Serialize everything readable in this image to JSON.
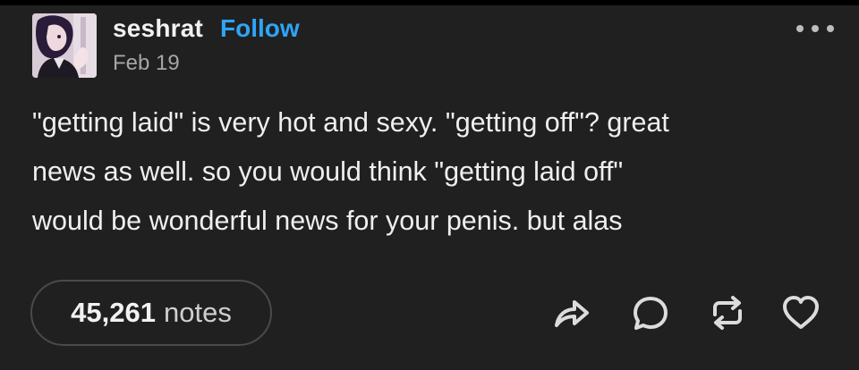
{
  "post": {
    "username": "seshrat",
    "follow_label": "Follow",
    "date": "Feb 19",
    "text": "\"getting laid\" is very hot and sexy. \"getting off\"? great\nnews as well. so you would think \"getting laid off\"\nwould be wonderful news for your penis. but alas",
    "notes_count": "45,261",
    "notes_label": "notes"
  },
  "actions": [
    "share-icon",
    "reply-icon",
    "reblog-icon",
    "like-icon"
  ],
  "colors": {
    "background": "#202020",
    "accent": "#2fa4f5",
    "text": "#efefef",
    "muted": "#a6a6a6"
  }
}
